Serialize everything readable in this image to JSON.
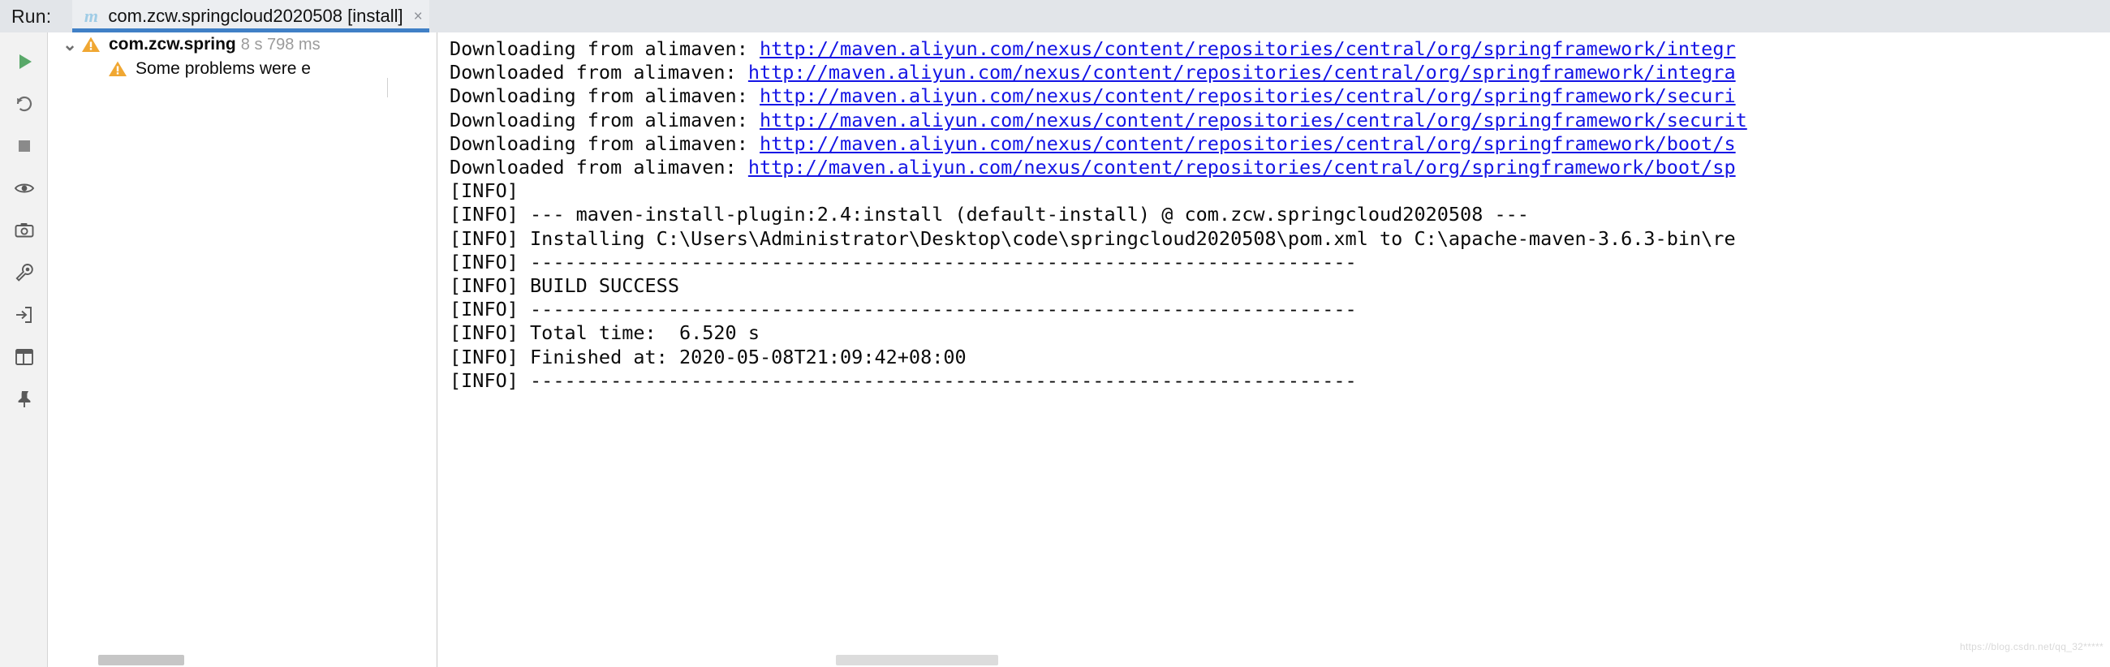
{
  "window": {
    "run_label": "Run:",
    "accent_color": "#4080c6",
    "warning_color": "#f0a732",
    "link_color": "#1515e5"
  },
  "tabs": [
    {
      "icon": "maven-m-icon",
      "icon_glyph": "m",
      "title": "com.zcw.springcloud2020508 [install]",
      "close_glyph": "×",
      "selected": true
    }
  ],
  "toolbar": {
    "buttons": [
      {
        "name": "rerun-button",
        "icon": "play-icon",
        "tooltip": "Rerun"
      },
      {
        "name": "rerun-failed-button",
        "icon": "rerun-failed-icon",
        "tooltip": "Rerun failed tests"
      },
      {
        "name": "stop-button",
        "icon": "stop-icon",
        "tooltip": "Stop"
      },
      {
        "name": "toggle-visibility-button",
        "icon": "eye-icon",
        "tooltip": "Filter"
      },
      {
        "name": "export-button",
        "icon": "camera-icon",
        "tooltip": "Export test results"
      },
      {
        "name": "settings-button",
        "icon": "wrench-icon",
        "tooltip": "Settings"
      },
      {
        "name": "scroll-to-end-button",
        "icon": "arrow-into-box-icon",
        "tooltip": "Scroll to end"
      },
      {
        "name": "layout-button",
        "icon": "grid-icon",
        "tooltip": "Layout"
      },
      {
        "name": "pin-tab-button",
        "icon": "pin-icon",
        "tooltip": "Pin Tab"
      }
    ]
  },
  "tree": {
    "rows": [
      {
        "name": "tree-row-root",
        "twisty": "⌄",
        "icon": "warning-triangle-icon",
        "label": "com.zcw.spring",
        "time": "8 s 798 ms",
        "bold": true,
        "level": 0
      },
      {
        "name": "tree-row-problems",
        "twisty": "",
        "icon": "warning-triangle-icon",
        "label": "Some problems were e",
        "time": "",
        "bold": false,
        "level": 1
      }
    ]
  },
  "console": {
    "lines": [
      {
        "prefix": "Downloading from alimaven: ",
        "link": "http://maven.aliyun.com/nexus/content/repositories/central/org/springframework/integr"
      },
      {
        "prefix": "Downloaded from alimaven: ",
        "link": "http://maven.aliyun.com/nexus/content/repositories/central/org/springframework/integra"
      },
      {
        "prefix": "Downloading from alimaven: ",
        "link": "http://maven.aliyun.com/nexus/content/repositories/central/org/springframework/securi"
      },
      {
        "prefix": "Downloading from alimaven: ",
        "link": "http://maven.aliyun.com/nexus/content/repositories/central/org/springframework/securit"
      },
      {
        "prefix": "Downloading from alimaven: ",
        "link": "http://maven.aliyun.com/nexus/content/repositories/central/org/springframework/boot/s"
      },
      {
        "prefix": "Downloaded from alimaven: ",
        "link": "http://maven.aliyun.com/nexus/content/repositories/central/org/springframework/boot/sp"
      },
      {
        "prefix": "[INFO] ",
        "link": ""
      },
      {
        "prefix": "[INFO] --- maven-install-plugin:2.4:install (default-install) @ com.zcw.springcloud2020508 ---",
        "link": ""
      },
      {
        "prefix": "[INFO] Installing C:\\Users\\Administrator\\Desktop\\code\\springcloud2020508\\pom.xml to C:\\apache-maven-3.6.3-bin\\re",
        "link": ""
      },
      {
        "prefix": "[INFO] ------------------------------------------------------------------------",
        "link": ""
      },
      {
        "prefix": "[INFO] BUILD SUCCESS",
        "link": ""
      },
      {
        "prefix": "[INFO] ------------------------------------------------------------------------",
        "link": ""
      },
      {
        "prefix": "[INFO] Total time:  6.520 s",
        "link": ""
      },
      {
        "prefix": "[INFO] Finished at: 2020-05-08T21:09:42+08:00",
        "link": ""
      },
      {
        "prefix": "[INFO] ------------------------------------------------------------------------",
        "link": ""
      }
    ]
  },
  "watermark": {
    "text": "https://blog.csdn.net/qq_32*****"
  }
}
